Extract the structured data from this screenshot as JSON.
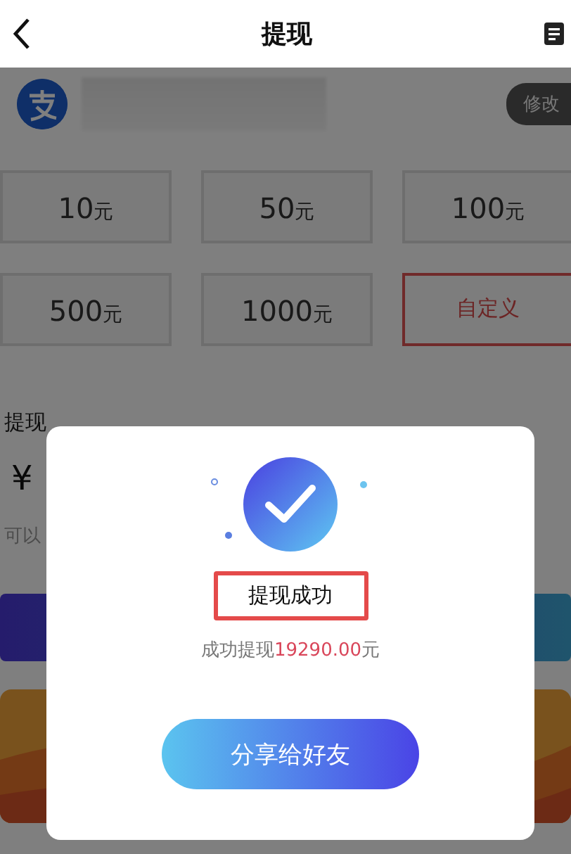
{
  "header": {
    "title": "提现"
  },
  "account": {
    "edit_button": "修改"
  },
  "amounts": [
    {
      "kind": "amount",
      "value": "10",
      "unit": "元",
      "selected": false
    },
    {
      "kind": "amount",
      "value": "50",
      "unit": "元",
      "selected": false
    },
    {
      "kind": "amount",
      "value": "100",
      "unit": "元",
      "selected": false
    },
    {
      "kind": "amount",
      "value": "500",
      "unit": "元",
      "selected": false
    },
    {
      "kind": "amount",
      "value": "1000",
      "unit": "元",
      "selected": false
    },
    {
      "kind": "custom",
      "value": "自定义",
      "selected": true
    }
  ],
  "amount_section": {
    "label": "提现",
    "currency": "¥",
    "hint": "可以"
  },
  "dialog": {
    "title": "提现成功",
    "message": "成功提现",
    "amount": "19290.00",
    "unit": "元",
    "button": "分享给好友"
  }
}
